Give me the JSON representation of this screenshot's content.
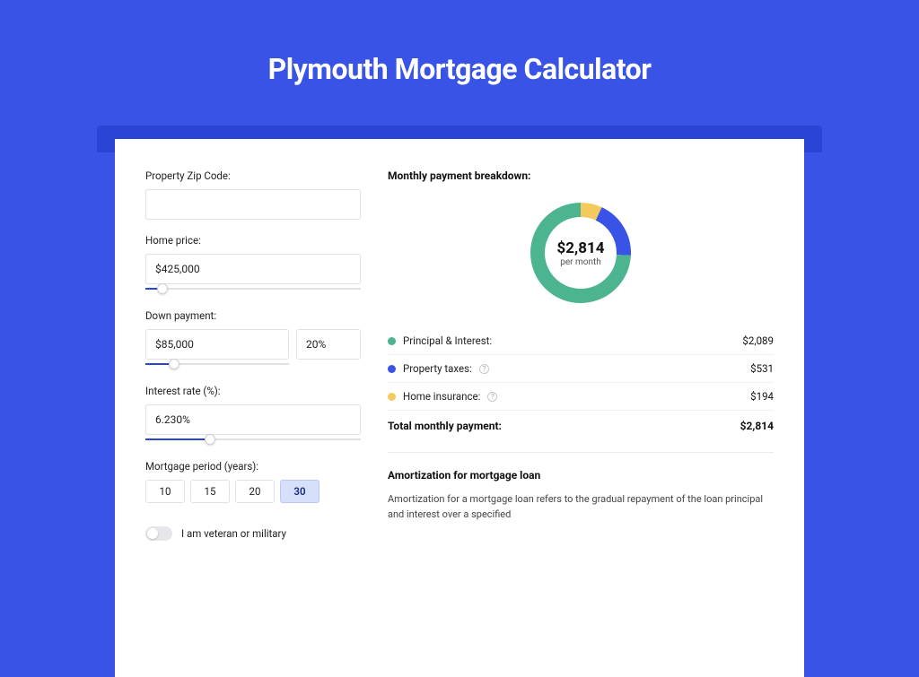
{
  "title": "Plymouth Mortgage Calculator",
  "form": {
    "zip_label": "Property Zip Code:",
    "zip_value": "",
    "home_price_label": "Home price:",
    "home_price_value": "$425,000",
    "home_price_slider_pct": 8,
    "down_payment_label": "Down payment:",
    "down_payment_value": "$85,000",
    "down_payment_pct_value": "20%",
    "down_payment_slider_pct": 20,
    "interest_label": "Interest rate (%):",
    "interest_value": "6.230%",
    "interest_slider_pct": 30,
    "period_label": "Mortgage period (years):",
    "periods": [
      "10",
      "15",
      "20",
      "30"
    ],
    "period_active_index": 3,
    "veteran_label": "I am veteran or military",
    "veteran_on": false
  },
  "breakdown": {
    "title": "Monthly payment breakdown:",
    "donut_total": "$2,814",
    "donut_sub": "per month",
    "items": [
      {
        "label": "Principal & Interest:",
        "value": "$2,089",
        "color": "#4cb58f",
        "help": false,
        "pct": 74.2
      },
      {
        "label": "Property taxes:",
        "value": "$531",
        "color": "#3853e5",
        "help": true,
        "pct": 18.9
      },
      {
        "label": "Home insurance:",
        "value": "$194",
        "color": "#f4c95d",
        "help": true,
        "pct": 6.9
      }
    ],
    "total_label": "Total monthly payment:",
    "total_value": "$2,814"
  },
  "amortization": {
    "title": "Amortization for mortgage loan",
    "body": "Amortization for a mortgage loan refers to the gradual repayment of the loan principal and interest over a specified"
  },
  "chart_data": {
    "type": "pie",
    "title": "Monthly payment breakdown",
    "categories": [
      "Principal & Interest",
      "Property taxes",
      "Home insurance"
    ],
    "values": [
      2089,
      531,
      194
    ],
    "total": 2814,
    "unit": "USD per month"
  }
}
